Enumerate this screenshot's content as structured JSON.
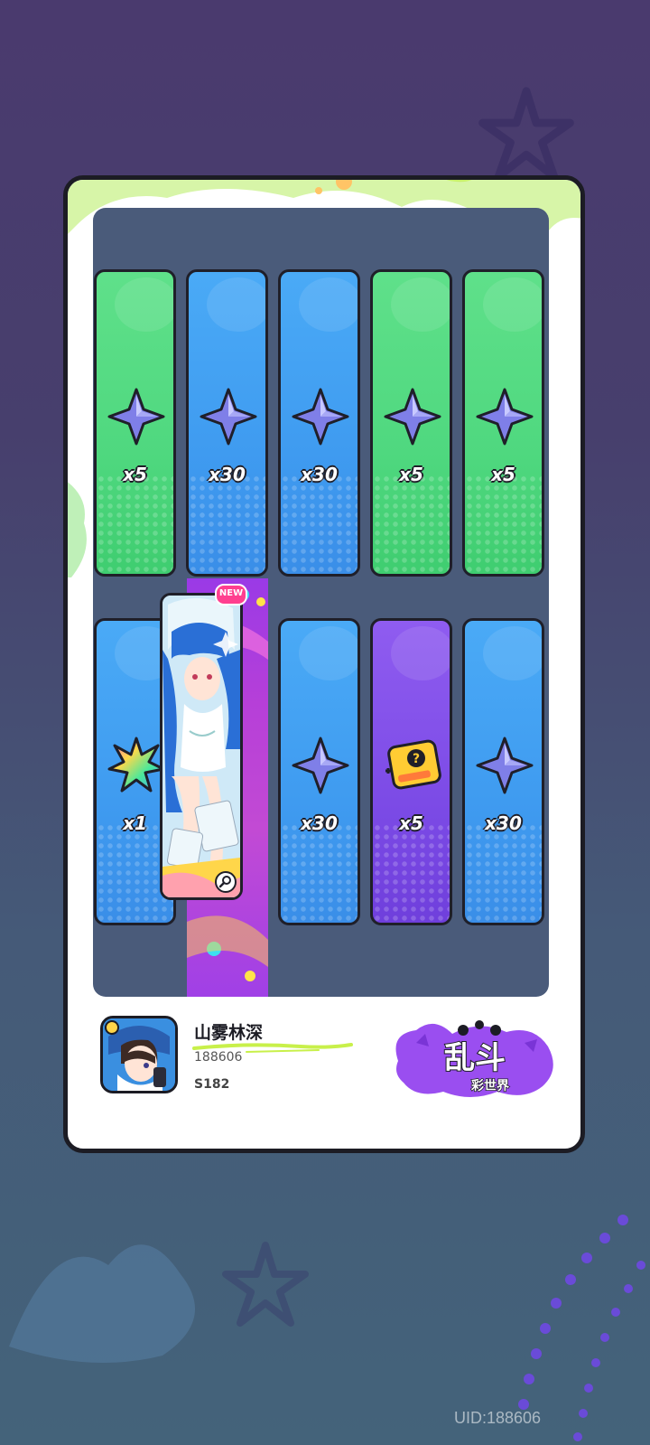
{
  "rewards_top": [
    {
      "color": "green",
      "item": "star-crystal",
      "qty": "x5"
    },
    {
      "color": "blue",
      "item": "star-crystal",
      "qty": "x30"
    },
    {
      "color": "blue",
      "item": "star-crystal",
      "qty": "x30"
    },
    {
      "color": "green",
      "item": "star-crystal",
      "qty": "x5"
    },
    {
      "color": "green",
      "item": "star-crystal",
      "qty": "x5"
    }
  ],
  "rewards_bottom": [
    {
      "color": "blue",
      "item": "rainbow-leaf",
      "qty": "x1"
    },
    {
      "color": "featured",
      "item": "character-card"
    },
    {
      "color": "blue",
      "item": "star-crystal",
      "qty": "x30"
    },
    {
      "color": "purple",
      "item": "mystery-ticket",
      "qty": "x5"
    },
    {
      "color": "blue",
      "item": "star-crystal",
      "qty": "x30"
    }
  ],
  "featured": {
    "badge": "NEW"
  },
  "profile": {
    "username": "山雾林深",
    "player_id": "188606",
    "server": "S182"
  },
  "logo": {
    "title": "乱斗",
    "subtitle": "彩世界"
  },
  "footer": {
    "uid": "UID:188606"
  },
  "colors": {
    "green_tile": "#4fd87f",
    "blue_tile": "#3f9bf0",
    "purple_tile": "#7c4be6",
    "board": "#4a5b7a",
    "background_top": "#4a3a6e",
    "background_bottom": "#44637a"
  }
}
